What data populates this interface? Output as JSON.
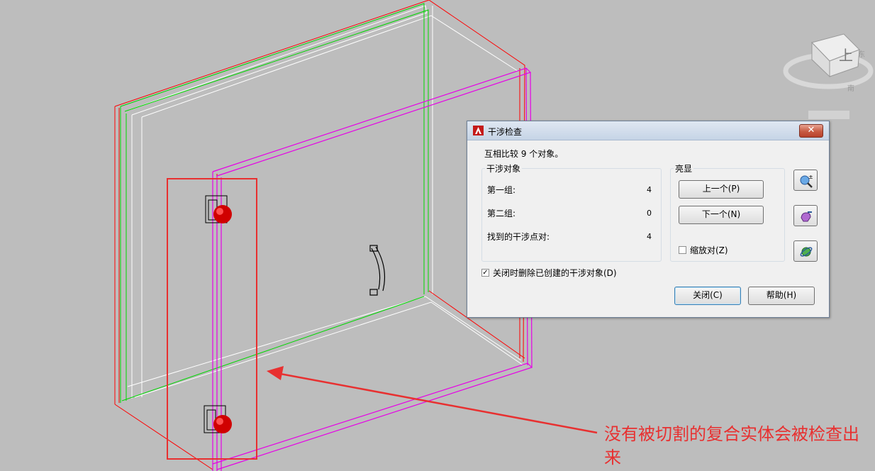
{
  "dialog": {
    "title": "干涉检查",
    "summary": "互相比较 9 个对象。",
    "close_x": "✕",
    "interfere_group": {
      "legend": "干涉对象",
      "rows": [
        {
          "label": "第一组:",
          "value": "4"
        },
        {
          "label": "第二组:",
          "value": "0"
        },
        {
          "label": "找到的干涉点对:",
          "value": "4"
        }
      ]
    },
    "highlight_group": {
      "legend": "亮显",
      "prev_button": "上一个(P)",
      "next_button": "下一个(N)",
      "zoom_pair_label": "缩放对(Z)",
      "zoom_pair_checked": false
    },
    "delete_on_close_label": "关闭时删除已创建的干涉对象(D)",
    "delete_on_close_checked": true,
    "close_button": "关闭(C)",
    "help_button": "帮助(H)",
    "side_icons": [
      "zoom-realtime-icon",
      "pan-icon",
      "orbit-icon"
    ]
  },
  "viewcube": {
    "face_label": "上",
    "compass_labels": [
      "南",
      "东"
    ]
  },
  "annotation": {
    "text": "没有被切割的复合实体会被检查出来",
    "color": "#e83030"
  },
  "colors": {
    "background": "#bdbdbd",
    "highlight_box": "#e83030",
    "edge_red": "#ff0000",
    "edge_green": "#00d800",
    "edge_magenta": "#e600e6",
    "knob_red": "#d00000"
  }
}
